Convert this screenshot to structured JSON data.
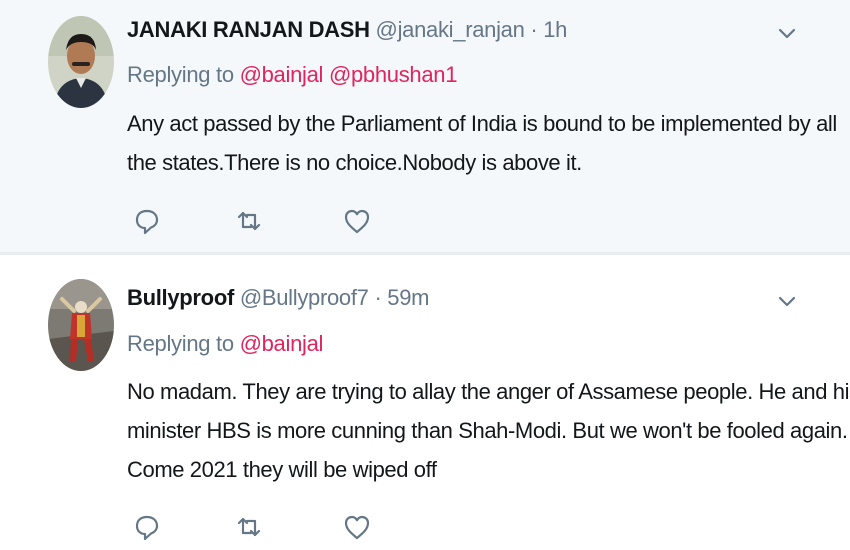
{
  "tweets": [
    {
      "author_name": "JANAKI RANJAN DASH",
      "handle": "@janaki_ranjan",
      "separator": "·",
      "time": "1h",
      "replying_prefix": "Replying to",
      "mentions": [
        "@bainjal",
        "@pbhushan1"
      ],
      "body_lines": [
        "Any act passed by the Parliament  of India is bound to be implemented  by all",
        "the states.There is no choice.Nobody is above it."
      ],
      "avatar_icon": "person-portrait",
      "actions": [
        "reply-icon",
        "retweet-icon",
        "like-icon"
      ]
    },
    {
      "author_name": "Bullyproof",
      "handle": "@Bullyproof7",
      "separator": "·",
      "time": "59m",
      "replying_prefix": "Replying to",
      "mentions": [
        "@bainjal"
      ],
      "body_lines": [
        "No madam. They are trying to allay the anger of Assamese people. He and his",
        "minister HBS is more cunning than Shah-Modi. But we won't be fooled again.",
        "Come 2021 they will be wiped off"
      ],
      "avatar_icon": "joker-figure",
      "actions": [
        "reply-icon",
        "retweet-icon",
        "like-icon"
      ]
    }
  ],
  "colors": {
    "muted": "#657786",
    "mention": "#e0245e",
    "text": "#14171a",
    "highlight_bg": "#f5f8fa"
  }
}
